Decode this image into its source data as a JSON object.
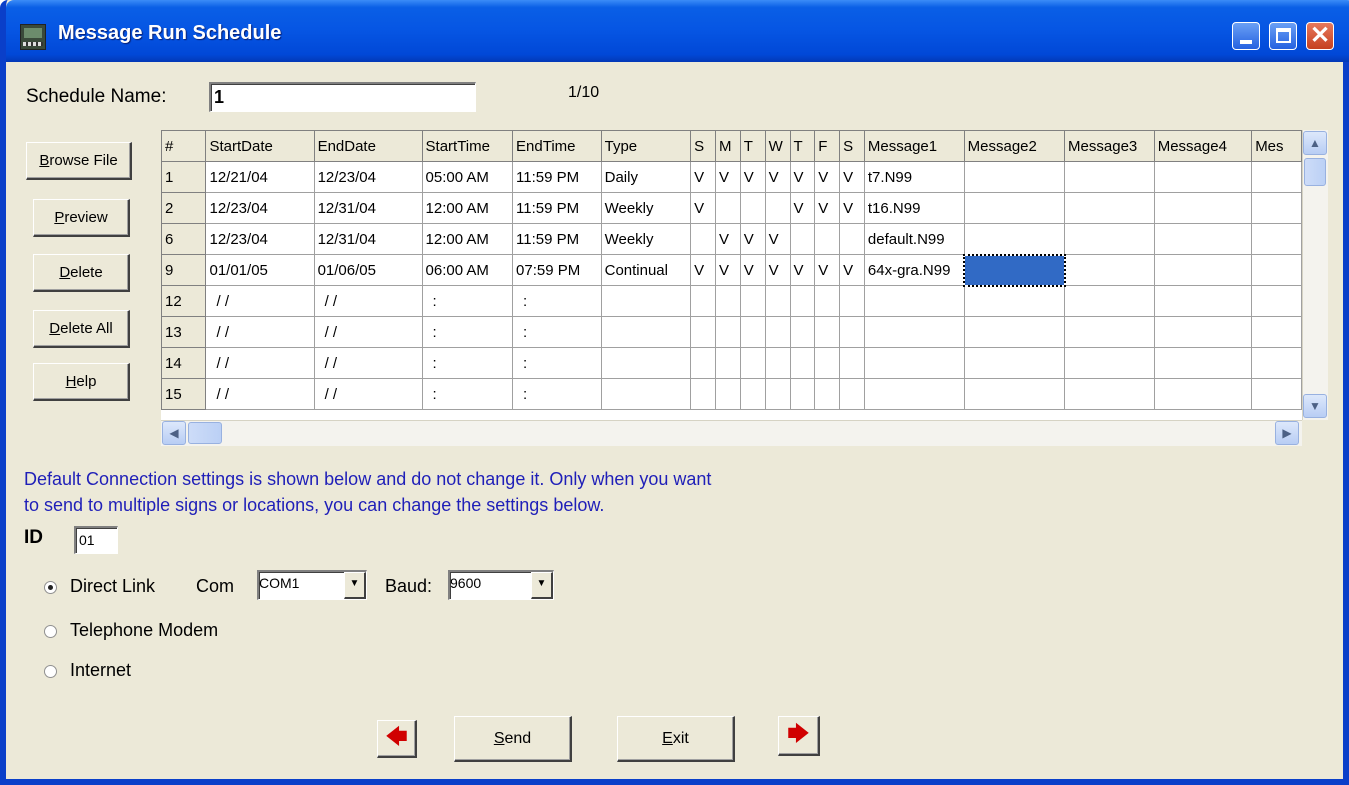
{
  "window": {
    "title": "Message Run Schedule"
  },
  "schedule": {
    "name_label": "Schedule Name:",
    "name_value": "1",
    "counter": "1/10"
  },
  "side_buttons": {
    "browse": {
      "u": "B",
      "rest": "rowse File"
    },
    "preview": {
      "u": "P",
      "rest": "review"
    },
    "delete": {
      "u": "D",
      "rest": "elete"
    },
    "delete_all": {
      "u": "D",
      "rest": "elete All"
    },
    "help": {
      "u": "H",
      "rest": "elp"
    }
  },
  "grid": {
    "headers": [
      "#",
      "StartDate",
      "EndDate",
      "StartTime",
      "EndTime",
      "Type",
      "S",
      "M",
      "T",
      "W",
      "T",
      "F",
      "S",
      "Message1",
      "Message2",
      "Message3",
      "Message4",
      "Mes"
    ],
    "rows": [
      [
        "1",
        "12/21/04",
        "12/23/04",
        "05:00 AM",
        "11:59 PM",
        "Daily",
        "V",
        "V",
        "V",
        "V",
        "V",
        "V",
        "V",
        "t7.N99",
        "",
        "",
        "",
        ""
      ],
      [
        "2",
        "12/23/04",
        "12/31/04",
        "12:00 AM",
        "11:59 PM",
        "Weekly",
        "V",
        "",
        "",
        "",
        "V",
        "V",
        "V",
        "t16.N99",
        "",
        "",
        "",
        ""
      ],
      [
        "6",
        "12/23/04",
        "12/31/04",
        "12:00 AM",
        "11:59 PM",
        "Weekly",
        "",
        "V",
        "V",
        "V",
        "",
        "",
        "",
        "default.N99",
        "",
        "",
        "",
        ""
      ],
      [
        "9",
        "01/01/05",
        "01/06/05",
        "06:00 AM",
        "07:59 PM",
        "Continual",
        "V",
        "V",
        "V",
        "V",
        "V",
        "V",
        "V",
        "64x-gra.N99",
        "",
        "",
        "",
        ""
      ],
      [
        "12",
        " / /",
        " / /",
        ":",
        ":",
        "",
        "",
        "",
        "",
        "",
        "",
        "",
        "",
        "",
        "",
        "",
        "",
        ""
      ],
      [
        "13",
        " / /",
        " / /",
        ":",
        ":",
        "",
        "",
        "",
        "",
        "",
        "",
        "",
        "",
        "",
        "",
        "",
        "",
        ""
      ],
      [
        "14",
        " / /",
        " / /",
        ":",
        ":",
        "",
        "",
        "",
        "",
        "",
        "",
        "",
        "",
        "",
        "",
        "",
        "",
        ""
      ],
      [
        "15",
        " / /",
        " / /",
        ":",
        ":",
        "",
        "",
        "",
        "",
        "",
        "",
        "",
        "",
        "",
        "",
        "",
        "",
        ""
      ]
    ],
    "selected_cell": {
      "row": 3,
      "col": 14
    }
  },
  "info": {
    "line1": "Default Connection settings is shown below and do not change it. Only when you want",
    "line2": "to send to multiple signs or locations, you can change the settings below."
  },
  "connection": {
    "id_label": "ID",
    "id_value": "01",
    "direct_link_label": "Direct Link",
    "com_label": "Com",
    "com_value": "COM1",
    "baud_label": "Baud:",
    "baud_value": "9600",
    "telephone_label": "Telephone Modem",
    "internet_label": "Internet",
    "selected": "direct_link"
  },
  "bottom": {
    "send": {
      "u": "S",
      "rest": "end"
    },
    "exit": {
      "u": "E",
      "rest": "xit"
    }
  },
  "colors": {
    "title_blue": "#0655e3",
    "info_text": "#1f1fb8",
    "selection": "#316ac5",
    "arrow_red": "#d00000"
  },
  "icons": {
    "app": "app-icon",
    "minimize": "minimize-icon",
    "maximize": "maximize-icon",
    "close": "close-icon",
    "prev": "arrow-left-icon",
    "next": "arrow-right-icon"
  }
}
